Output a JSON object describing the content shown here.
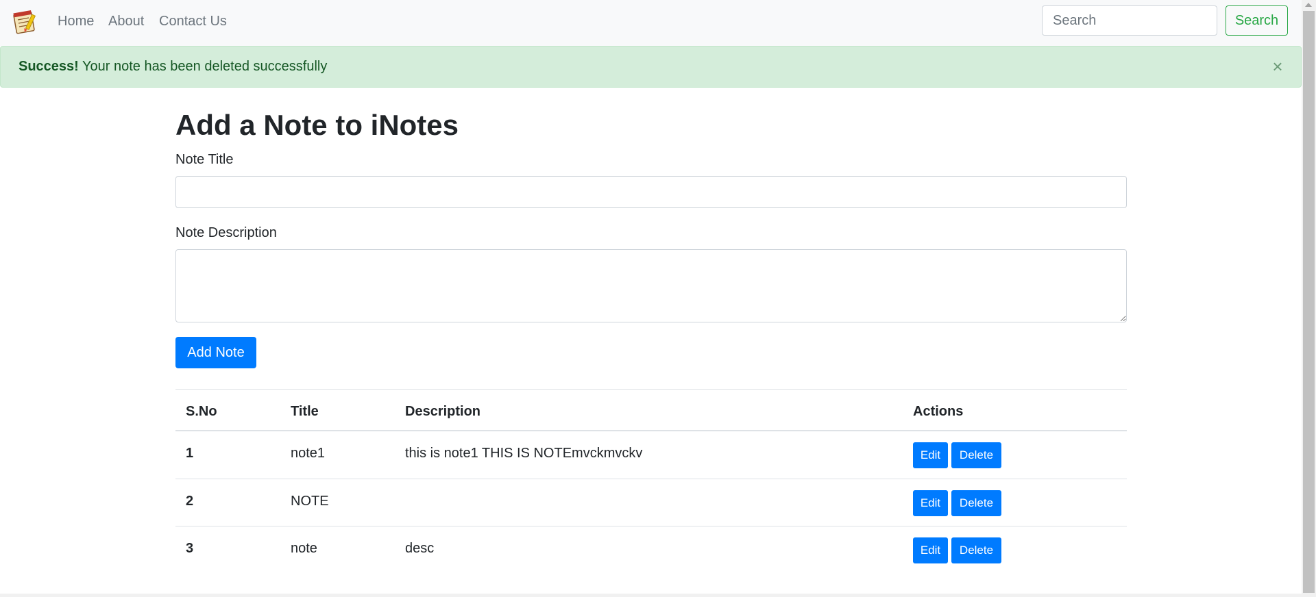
{
  "nav": {
    "links": [
      "Home",
      "About",
      "Contact Us"
    ],
    "search_placeholder": "Search",
    "search_button": "Search"
  },
  "alert": {
    "strong": "Success!",
    "message": " Your note has been deleted successfully",
    "close": "×"
  },
  "form": {
    "heading": "Add a Note to iNotes",
    "title_label": "Note Title",
    "title_value": "",
    "desc_label": "Note Description",
    "desc_value": "",
    "add_button": "Add Note"
  },
  "table": {
    "headers": [
      "S.No",
      "Title",
      "Description",
      "Actions"
    ],
    "rows": [
      {
        "sno": "1",
        "title": "note1",
        "desc": "this is note1 THIS IS NOTEmvckmvckv"
      },
      {
        "sno": "2",
        "title": "NOTE",
        "desc": ""
      },
      {
        "sno": "3",
        "title": "note",
        "desc": "desc"
      }
    ],
    "edit_label": "Edit",
    "delete_label": "Delete"
  },
  "colors": {
    "primary": "#007bff",
    "success": "#28a745",
    "alert_bg": "#d4edda",
    "alert_text": "#155724"
  }
}
